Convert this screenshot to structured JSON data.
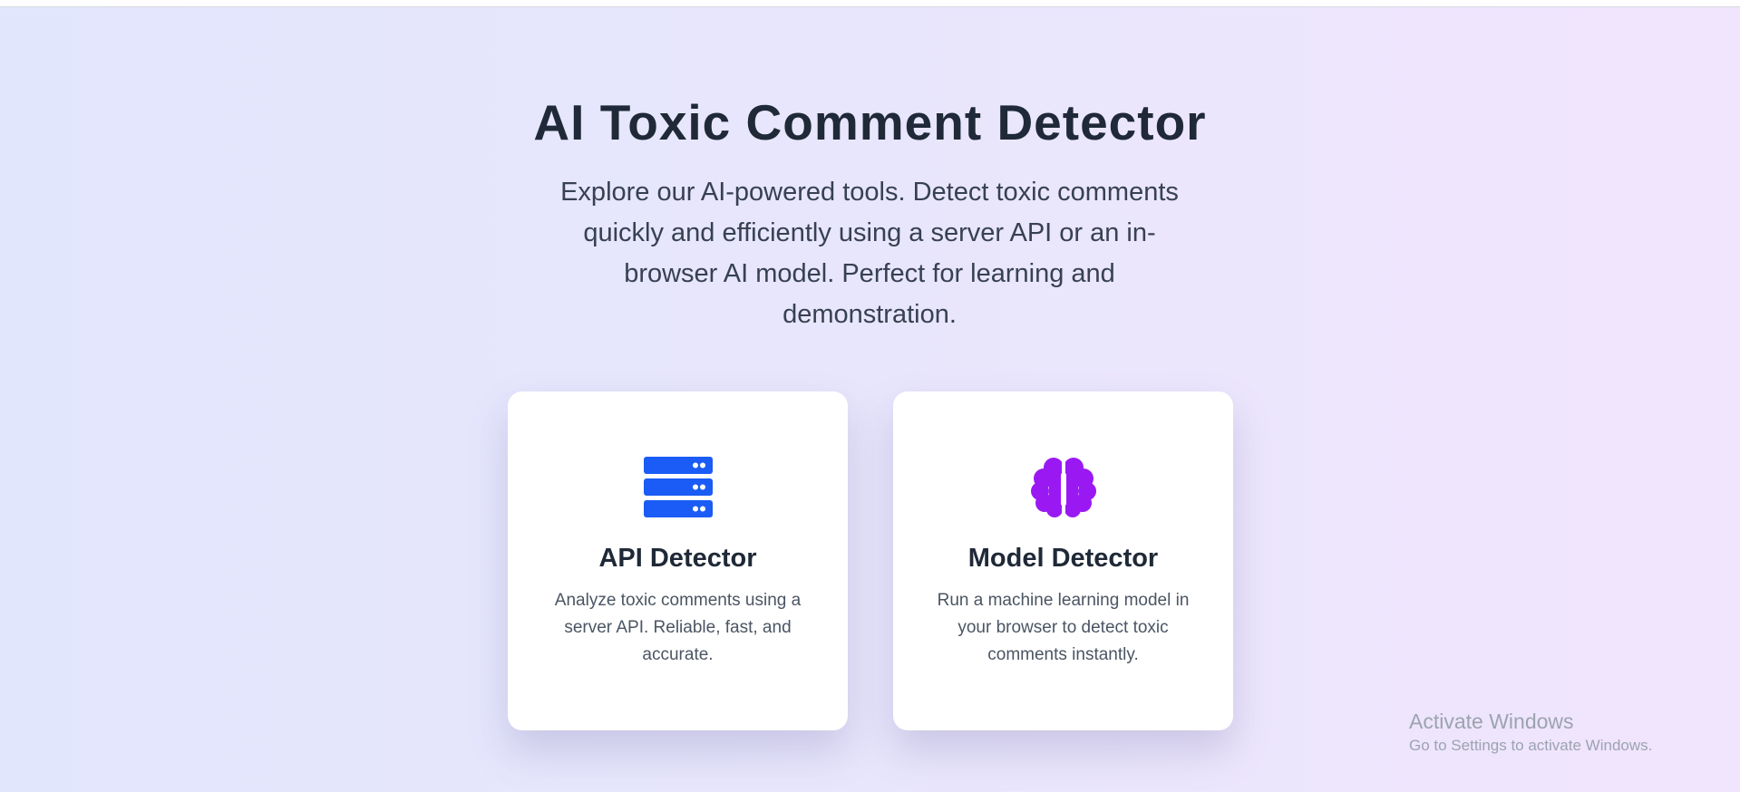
{
  "header": {
    "title": "AI Toxic Comment Detector",
    "subtitle": "Explore our AI-powered tools. Detect toxic comments quickly and efficiently using a server API or an in-browser AI model. Perfect for learning and demonstration."
  },
  "cards": [
    {
      "icon": "server-icon",
      "icon_color": "#1a5cf5",
      "title": "API Detector",
      "description": "Analyze toxic comments using a server API. Reliable, fast, and accurate."
    },
    {
      "icon": "brain-icon",
      "icon_color": "#9a19f3",
      "title": "Model Detector",
      "description": "Run a machine learning model in your browser to detect toxic comments instantly."
    }
  ],
  "watermark": {
    "title": "Activate Windows",
    "subtitle": "Go to Settings to activate Windows."
  },
  "colors": {
    "heading": "#1f2937",
    "body_text": "#374151",
    "background_start": "#e2e6fd",
    "background_end": "#f1e5fd"
  }
}
